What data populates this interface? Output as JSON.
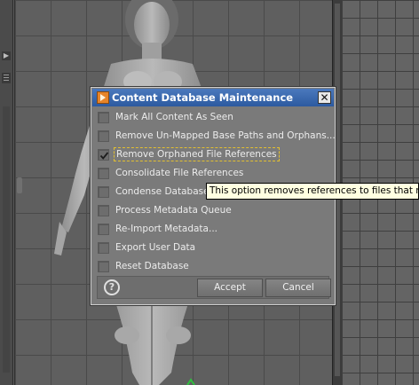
{
  "dialog": {
    "title": "Content Database Maintenance",
    "close_label": "✕",
    "options": [
      {
        "label": "Mark All Content As Seen",
        "checked": false
      },
      {
        "label": "Remove Un-Mapped Base Paths and Orphans...",
        "checked": false
      },
      {
        "label": "Remove Orphaned File References",
        "checked": true
      },
      {
        "label": "Consolidate File References",
        "checked": false
      },
      {
        "label": "Condense Database",
        "checked": false
      },
      {
        "label": "Process Metadata Queue",
        "checked": false
      },
      {
        "label": "Re-Import Metadata...",
        "checked": false
      },
      {
        "label": "Export User Data",
        "checked": false
      },
      {
        "label": "Reset Database",
        "checked": false
      }
    ],
    "help_label": "?",
    "accept_label": "Accept",
    "cancel_label": "Cancel"
  },
  "tooltip": {
    "text": "This option removes references to files that no lo"
  },
  "colors": {
    "titlebar": "#2c5aa0",
    "dialog_bg": "#7a7a7a",
    "tooltip_bg": "#ffffe1",
    "hover_outline": "#e3c030"
  },
  "icons": {
    "app": "app-logo-icon",
    "close": "close-icon",
    "help": "help-icon",
    "check": "checkmark-icon"
  }
}
